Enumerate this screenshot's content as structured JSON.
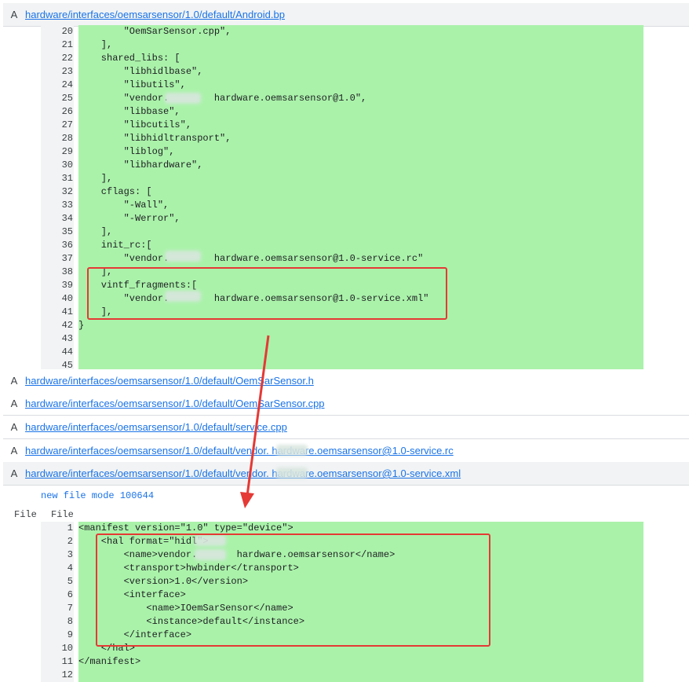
{
  "files": [
    {
      "status": "A",
      "path": "hardware/interfaces/oemsarsensor/1.0/default/Android.bp"
    },
    {
      "status": "A",
      "path": "hardware/interfaces/oemsarsensor/1.0/default/OemSarSensor.h"
    },
    {
      "status": "A",
      "path": "hardware/interfaces/oemsarsensor/1.0/default/OemSarSensor.cpp"
    },
    {
      "status": "A",
      "path": "hardware/interfaces/oemsarsensor/1.0/default/service.cpp"
    },
    {
      "status": "A",
      "path": "hardware/interfaces/oemsarsensor/1.0/default/vendor.    hardware.oemsarsensor@1.0-service.rc"
    },
    {
      "status": "A",
      "path": "hardware/interfaces/oemsarsensor/1.0/default/vendor.    hardware.oemsarsensor@1.0-service.xml"
    }
  ],
  "android_bp_lines": [
    {
      "n": "20",
      "t": "        \"OemSarSensor.cpp\","
    },
    {
      "n": "21",
      "t": "    ],"
    },
    {
      "n": "22",
      "t": "    shared_libs: ["
    },
    {
      "n": "23",
      "t": "        \"libhidlbase\","
    },
    {
      "n": "24",
      "t": "        \"libutils\","
    },
    {
      "n": "25",
      "t": "        \"vendor.        hardware.oemsarsensor@1.0\","
    },
    {
      "n": "26",
      "t": "        \"libbase\","
    },
    {
      "n": "27",
      "t": "        \"libcutils\","
    },
    {
      "n": "28",
      "t": "        \"libhidltransport\","
    },
    {
      "n": "29",
      "t": "        \"liblog\","
    },
    {
      "n": "30",
      "t": "        \"libhardware\","
    },
    {
      "n": "31",
      "t": "    ],"
    },
    {
      "n": "32",
      "t": "    cflags: ["
    },
    {
      "n": "33",
      "t": "        \"-Wall\","
    },
    {
      "n": "34",
      "t": "        \"-Werror\","
    },
    {
      "n": "35",
      "t": "    ],"
    },
    {
      "n": "36",
      "t": "    init_rc:["
    },
    {
      "n": "37",
      "t": "        \"vendor.        hardware.oemsarsensor@1.0-service.rc\""
    },
    {
      "n": "38",
      "t": "    ],"
    },
    {
      "n": "39",
      "t": "    vintf_fragments:["
    },
    {
      "n": "40",
      "t": "        \"vendor.        hardware.oemsarsensor@1.0-service.xml\""
    },
    {
      "n": "41",
      "t": "    ],"
    },
    {
      "n": "42",
      "t": "}"
    },
    {
      "n": "43",
      "t": ""
    },
    {
      "n": "44",
      "t": ""
    },
    {
      "n": "45",
      "t": ""
    }
  ],
  "new_file_mode": "new file mode 100644",
  "col_headers": [
    "File",
    "File"
  ],
  "xml_lines": [
    {
      "n": "1",
      "t": "<manifest version=\"1.0\" type=\"device\">"
    },
    {
      "n": "2",
      "t": "    <hal format=\"hidl\">"
    },
    {
      "n": "3",
      "t": "        <name>vendor.       hardware.oemsarsensor</name>"
    },
    {
      "n": "4",
      "t": "        <transport>hwbinder</transport>"
    },
    {
      "n": "5",
      "t": "        <version>1.0</version>"
    },
    {
      "n": "6",
      "t": "        <interface>"
    },
    {
      "n": "7",
      "t": "            <name>IOemSarSensor</name>"
    },
    {
      "n": "8",
      "t": "            <instance>default</instance>"
    },
    {
      "n": "9",
      "t": "        </interface>"
    },
    {
      "n": "10",
      "t": "    </hal>"
    },
    {
      "n": "11",
      "t": "</manifest>"
    },
    {
      "n": "12",
      "t": ""
    }
  ],
  "colors": {
    "added_line": "#aaf2aa",
    "link": "#1a73e8",
    "highlight_box": "#e53935"
  }
}
